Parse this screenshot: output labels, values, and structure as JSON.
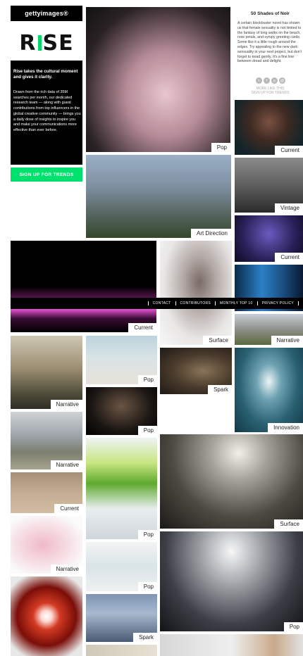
{
  "header": {
    "brand": "gettyimages®",
    "logo": "RISE"
  },
  "intro": {
    "headline": "Rise takes the cultural moment and gives it clarity.",
    "body": "Drawn from the rich data of 35M searches per month, our dedicated research team — along with guest contributions from top influencers in the global creative community — brings you a daily dose of insights to inspire you and make your communications more effective than ever before.",
    "signup_label": "SIGN UP FOR TRENDS"
  },
  "blog": {
    "title": "50 Shades of Noir",
    "body": "A certain blockbuster novel has shown us that female sexuality is not limited to the fantasy of long walks on the beach, rose petals, and syrupy greeting cards. Some like it a little rough around the edges. Try appealing to the new dark sensuality in your next project, but don't forget to tread gently. It's a fine line between dread and delight.",
    "share_icons": [
      "twitter-icon",
      "facebook-icon",
      "pinterest-icon",
      "email-icon"
    ],
    "more_line1": "MORE LIKE THIS",
    "more_line2": "SIGN UP FOR TRENDS"
  },
  "nav": {
    "items": [
      "CONTACT",
      "CONTRIBUTORS",
      "MONTHLY TOP 10",
      "PRIVACY POLICY"
    ]
  },
  "tiles": [
    {
      "id": "t1",
      "tag": "Pop",
      "desc": "Woman in flowing pink fabric"
    },
    {
      "id": "t2",
      "tag": "Current",
      "desc": "Smiling woman portrait"
    },
    {
      "id": "t3",
      "tag": "Art Direction",
      "desc": "Rio de Janeiro Christ statue"
    },
    {
      "id": "t4",
      "tag": "Vintage",
      "desc": "Vintage band photo"
    },
    {
      "id": "t5",
      "tag": "Current",
      "desc": "Stage performance"
    },
    {
      "id": "t6",
      "tag": "",
      "desc": "Blue stage curtain"
    },
    {
      "id": "t7",
      "tag": "Current",
      "desc": "Pink-lit building at night"
    },
    {
      "id": "t8",
      "tag": "Surface",
      "desc": "Blurred portrait"
    },
    {
      "id": "t9",
      "tag": "Narrative",
      "desc": "Large mansion"
    },
    {
      "id": "t10",
      "tag": "Narrative",
      "desc": "Two elderly women"
    },
    {
      "id": "t11",
      "tag": "Pop",
      "desc": "Man jumping on beach"
    },
    {
      "id": "t12",
      "tag": "Spark",
      "desc": "Group of people"
    },
    {
      "id": "t13",
      "tag": "Pop",
      "desc": "Dancers on stage"
    },
    {
      "id": "t14",
      "tag": "Innovation",
      "desc": "Cloud in blue sky"
    },
    {
      "id": "t15",
      "tag": "Narrative",
      "desc": "Classroom desks"
    },
    {
      "id": "t16",
      "tag": "Pop",
      "desc": "Green fabric dancer"
    },
    {
      "id": "t17",
      "tag": "Surface",
      "desc": "Futuristic city"
    },
    {
      "id": "t18",
      "tag": "Current",
      "desc": "Sandy surface"
    },
    {
      "id": "t19",
      "tag": "Narrative",
      "desc": "Pink toy fire truck"
    },
    {
      "id": "t20",
      "tag": "Pop",
      "desc": "Bright white scene"
    },
    {
      "id": "t21",
      "tag": "Pop",
      "desc": "Runway fashion show"
    },
    {
      "id": "t22",
      "tag": "",
      "desc": "Sliced tomato"
    },
    {
      "id": "t23",
      "tag": "Spark",
      "desc": "Crumpled surface"
    },
    {
      "id": "t24",
      "tag": "",
      "desc": "Bottom strip images"
    }
  ],
  "colors": {
    "accent": "#00e06c",
    "black": "#000000"
  }
}
